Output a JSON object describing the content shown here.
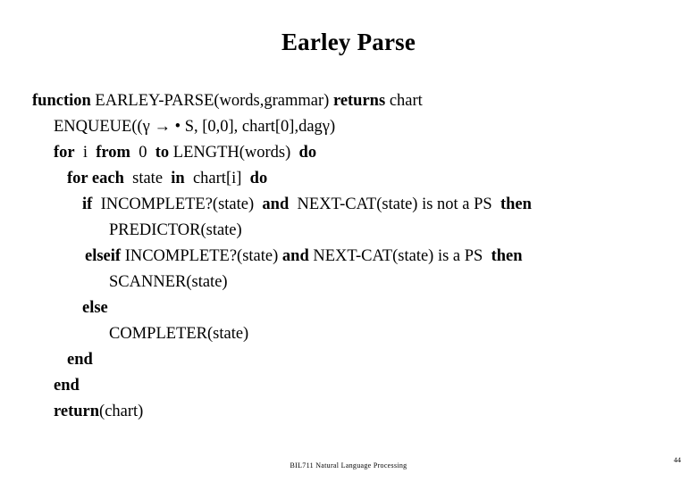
{
  "slide": {
    "title": "Earley Parse",
    "background_color": "#ffffff",
    "text_color": "#000000"
  },
  "pseudocode": {
    "lines": [
      {
        "id": "line-function",
        "indent": 0,
        "segments": [
          {
            "text": "function ",
            "bold": true
          },
          {
            "text": "EARLEY-PARSE(words,grammar) ",
            "bold": false
          },
          {
            "text": "returns",
            "bold": true
          },
          {
            "text": " chart",
            "bold": false
          }
        ]
      },
      {
        "id": "line-enqueue",
        "indent": 1,
        "segments": [
          {
            "text": "ENQUEUE((γ → • S, [0,0], chart[0],dagγ)",
            "bold": false
          }
        ]
      },
      {
        "id": "line-for-i",
        "indent": 2,
        "segments": [
          {
            "text": "for",
            "bold": true
          },
          {
            "text": "  i  ",
            "bold": false
          },
          {
            "text": "from",
            "bold": true
          },
          {
            "text": "  0  ",
            "bold": false
          },
          {
            "text": "to",
            "bold": true
          },
          {
            "text": " LENGTH(words)  ",
            "bold": false
          },
          {
            "text": "do",
            "bold": true
          }
        ]
      },
      {
        "id": "line-for-each",
        "indent": 3,
        "segments": [
          {
            "text": "for each",
            "bold": true
          },
          {
            "text": "  state  ",
            "bold": false
          },
          {
            "text": "in",
            "bold": true
          },
          {
            "text": "  chart[i]  ",
            "bold": false
          },
          {
            "text": "do",
            "bold": true
          }
        ]
      },
      {
        "id": "line-if",
        "indent": 4,
        "segments": [
          {
            "text": "if",
            "bold": true
          },
          {
            "text": "  INCOMPLETE?(state)  ",
            "bold": false
          },
          {
            "text": "and",
            "bold": true
          },
          {
            "text": "  NEXT-CAT(state) is not a PS  ",
            "bold": false
          },
          {
            "text": "then",
            "bold": true
          }
        ]
      },
      {
        "id": "line-predictor",
        "indent": 5,
        "segments": [
          {
            "text": "PREDICTOR(state)",
            "bold": false
          }
        ]
      },
      {
        "id": "line-elseif",
        "indent": 6,
        "segments": [
          {
            "text": "elseif",
            "bold": true
          },
          {
            "text": " INCOMPLETE?(state) ",
            "bold": false
          },
          {
            "text": "and",
            "bold": true
          },
          {
            "text": " NEXT-CAT(state) is a PS  ",
            "bold": false
          },
          {
            "text": "then",
            "bold": true
          }
        ]
      },
      {
        "id": "line-scanner",
        "indent": 7,
        "segments": [
          {
            "text": "SCANNER(state)",
            "bold": false
          }
        ]
      },
      {
        "id": "line-else",
        "indent": 8,
        "segments": [
          {
            "text": "else",
            "bold": true
          }
        ]
      },
      {
        "id": "line-completer",
        "indent": 9,
        "segments": [
          {
            "text": "COMPLETER(state)",
            "bold": false
          }
        ]
      },
      {
        "id": "line-end-inner",
        "indent": 10,
        "segments": [
          {
            "text": "end",
            "bold": true
          }
        ]
      },
      {
        "id": "line-end-outer",
        "indent": 11,
        "segments": [
          {
            "text": "end",
            "bold": true
          }
        ]
      },
      {
        "id": "line-return",
        "indent": 12,
        "segments": [
          {
            "text": "return",
            "bold": true
          },
          {
            "text": "(chart)",
            "bold": false
          }
        ]
      }
    ]
  },
  "footer": {
    "course_text": "BIL711 Natural Language Processing",
    "page_number": "44"
  }
}
